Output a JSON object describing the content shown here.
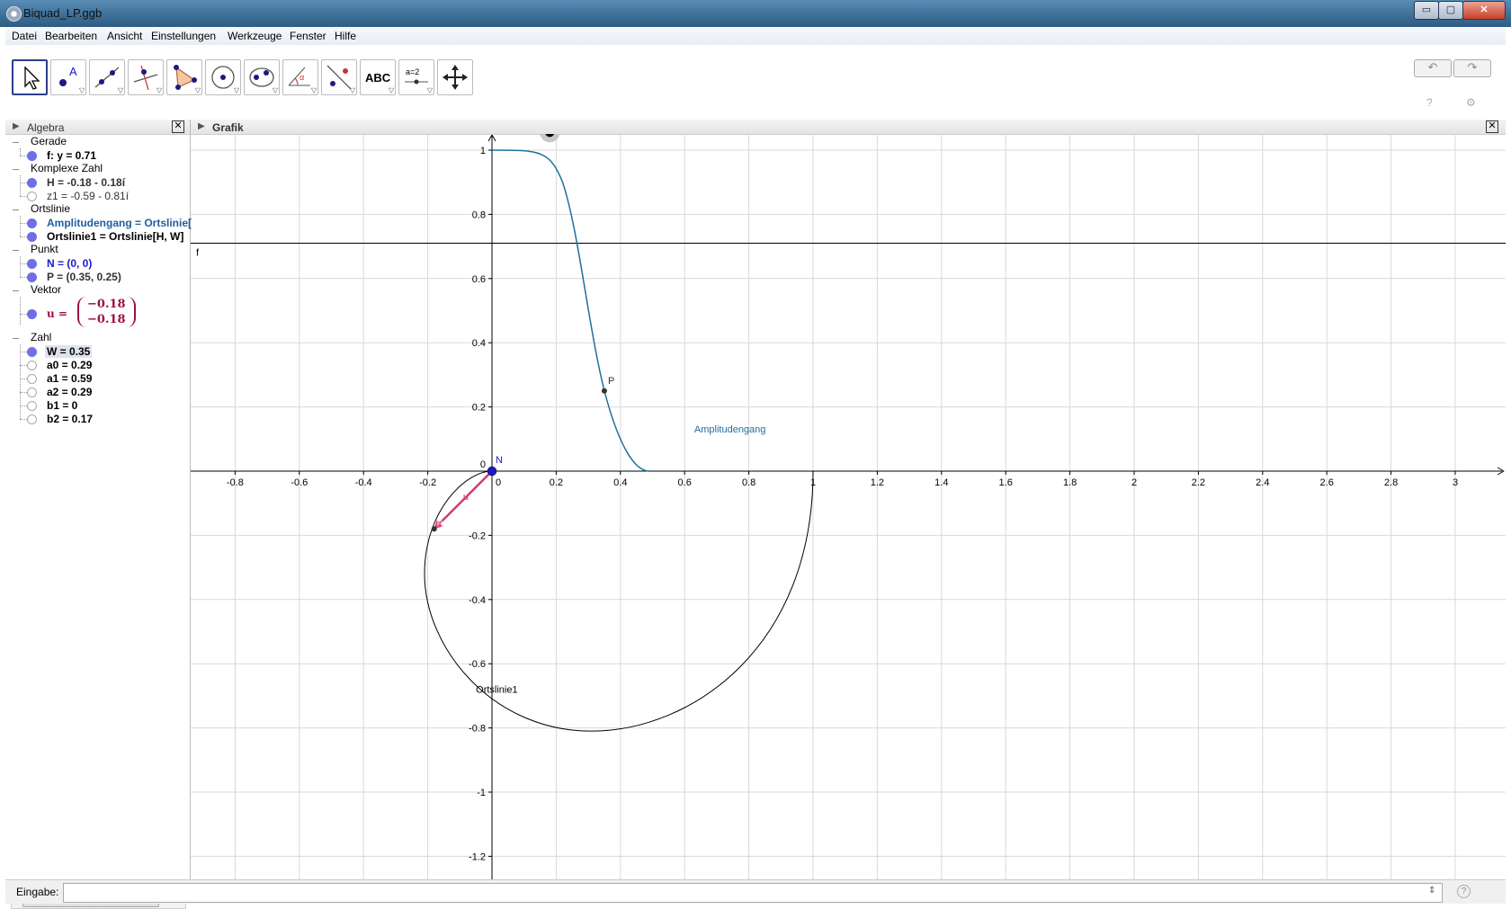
{
  "window": {
    "title": "Biquad_LP.ggb",
    "minimize": "▭",
    "maximize": "▢",
    "close": "✕"
  },
  "menu": [
    "Datei",
    "Bearbeiten",
    "Ansicht",
    "Einstellungen",
    "Werkzeuge",
    "Fenster",
    "Hilfe"
  ],
  "toolbar": {
    "text_tool_label": "ABC",
    "slider_tool_label": "a=2",
    "undo": "↶",
    "redo": "↷",
    "help_icon": "question-icon",
    "settings_icon": "gear-icon"
  },
  "algebra": {
    "header": "Algebra",
    "categories": [
      {
        "name": "Gerade",
        "items": [
          {
            "text": "f: y = 0.71",
            "color": "#000000",
            "visible": true
          }
        ]
      },
      {
        "name": "Komplexe Zahl",
        "items": [
          {
            "text": "H = -0.18 - 0.18í",
            "color": "#333333",
            "visible": true
          },
          {
            "text": "z1 = -0.59 - 0.81í",
            "color": "#333333",
            "visible": false
          }
        ]
      },
      {
        "name": "Ortslinie",
        "items": [
          {
            "text": "Amplitudengang = Ortslinie[",
            "color": "#1f5f9e",
            "visible": true
          },
          {
            "text": "Ortslinie1 = Ortslinie[H, W]",
            "color": "#000000",
            "visible": true
          }
        ]
      },
      {
        "name": "Punkt",
        "items": [
          {
            "text": "N = (0, 0)",
            "color": "#1a1acc",
            "visible": true
          },
          {
            "text": "P = (0.35, 0.25)",
            "color": "#333333",
            "visible": true
          }
        ]
      },
      {
        "name": "Vektor",
        "items": [
          {
            "text": "u =",
            "color": "#a0103a",
            "visible": true,
            "matrix": [
              "−0.18",
              "−0.18"
            ]
          }
        ]
      },
      {
        "name": "Zahl",
        "items": [
          {
            "text": "W = 0.35",
            "color": "#000000",
            "visible": true
          },
          {
            "text": "a0 = 0.29",
            "color": "#000000",
            "visible": false
          },
          {
            "text": "a1 = 0.59",
            "color": "#000000",
            "visible": false
          },
          {
            "text": "a2 = 0.29",
            "color": "#000000",
            "visible": false
          },
          {
            "text": "b1 = 0",
            "color": "#000000",
            "visible": false
          },
          {
            "text": "b2 = 0.17",
            "color": "#000000",
            "visible": false
          }
        ]
      }
    ],
    "scroll_thumb": "III"
  },
  "grafik": {
    "header": "Grafik",
    "slider_label": "W = 0.35",
    "slider_value": 0.35,
    "slider_range": [
      0,
      0.57
    ],
    "x_axis": {
      "min": -0.94,
      "max": 3.13,
      "ticks": [
        -0.8,
        -0.6,
        -0.4,
        -0.2,
        0,
        0.2,
        0.4,
        0.6,
        0.8,
        1,
        1.2,
        1.4,
        1.6,
        1.8,
        2,
        2.2,
        2.4,
        2.6,
        2.8,
        3
      ]
    },
    "y_axis": {
      "min": -1.27,
      "max": 1.13,
      "ticks": [
        -1.2,
        -1,
        -0.8,
        -0.6,
        -0.4,
        -0.2,
        0,
        0.2,
        0.4,
        0.6,
        0.8,
        1
      ]
    },
    "line_f": {
      "y": 0.71,
      "label": "f"
    },
    "points": {
      "N": {
        "x": 0,
        "y": 0,
        "label": "N"
      },
      "P": {
        "x": 0.35,
        "y": 0.25,
        "label": "P"
      },
      "H": {
        "x": -0.18,
        "y": -0.18,
        "label": "H"
      }
    },
    "vector_u_label": "u",
    "curve_labels": {
      "amplitude": "Amplitudengang",
      "nyquist": "Ortslinie1"
    },
    "colors": {
      "amplitude": "#1f6fa0",
      "vector": "#d43b6a",
      "point_N": "#1a1acc",
      "grid": "#d9d9d9"
    },
    "coeffs": {
      "a0": 0.29,
      "a1": 0.59,
      "a2": 0.29,
      "b1": 0,
      "b2": 0.17
    }
  },
  "input": {
    "label": "Eingabe:",
    "help": "?"
  }
}
